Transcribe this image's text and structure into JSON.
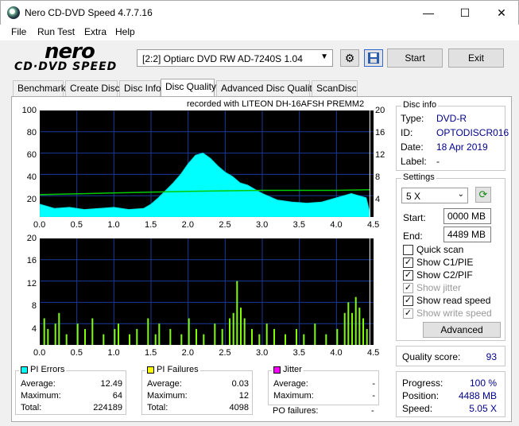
{
  "window": {
    "title": "Nero CD-DVD Speed 4.7.7.16",
    "min": "—",
    "max": "☐",
    "close": "✕"
  },
  "menu": [
    "File",
    "Run Test",
    "Extra",
    "Help"
  ],
  "logo": {
    "top": "nero",
    "bottom": "CD·DVD SPEED"
  },
  "toolbar": {
    "drive": "[2:2]  Optiarc DVD RW AD-7240S 1.04",
    "start": "Start",
    "exit": "Exit"
  },
  "tabs": [
    "Benchmark",
    "Create Disc",
    "Disc Info",
    "Disc Quality",
    "Advanced Disc Quality",
    "ScanDisc"
  ],
  "recorded_with": "recorded with LITEON   DH-16AFSH PREMM2",
  "disc_info": {
    "title": "Disc info",
    "rows": [
      {
        "label": "Type:",
        "value": "DVD-R"
      },
      {
        "label": "ID:",
        "value": "OPTODISCR016"
      },
      {
        "label": "Date:",
        "value": "18 Apr 2019"
      },
      {
        "label": "Label:",
        "value": "-"
      }
    ]
  },
  "settings": {
    "title": "Settings",
    "speed": "5 X",
    "start_label": "Start:",
    "start_value": "0000 MB",
    "end_label": "End:",
    "end_value": "4489 MB",
    "checks": [
      {
        "label": "Quick scan",
        "checked": false,
        "disabled": false
      },
      {
        "label": "Show C1/PIE",
        "checked": true,
        "disabled": false
      },
      {
        "label": "Show C2/PIF",
        "checked": true,
        "disabled": false
      },
      {
        "label": "Show jitter",
        "checked": true,
        "disabled": true
      },
      {
        "label": "Show read speed",
        "checked": true,
        "disabled": false
      },
      {
        "label": "Show write speed",
        "checked": true,
        "disabled": true
      }
    ],
    "advanced": "Advanced"
  },
  "quality": {
    "label": "Quality score:",
    "value": "93"
  },
  "progress": {
    "rows": [
      {
        "label": "Progress:",
        "value": "100 %"
      },
      {
        "label": "Position:",
        "value": "4488 MB"
      },
      {
        "label": "Speed:",
        "value": "5.05 X"
      }
    ]
  },
  "pi_errors": {
    "title": "PI Errors",
    "color": "#00ffff",
    "rows": [
      {
        "label": "Average:",
        "value": "12.49"
      },
      {
        "label": "Maximum:",
        "value": "64"
      },
      {
        "label": "Total:",
        "value": "224189"
      }
    ]
  },
  "pi_failures": {
    "title": "PI Failures",
    "color": "#ffff00",
    "rows": [
      {
        "label": "Average:",
        "value": "0.03"
      },
      {
        "label": "Maximum:",
        "value": "12"
      },
      {
        "label": "Total:",
        "value": "4098"
      }
    ]
  },
  "jitter": {
    "title": "Jitter",
    "color": "#ff00ff",
    "rows": [
      {
        "label": "Average:",
        "value": "-"
      },
      {
        "label": "Maximum:",
        "value": "-"
      }
    ],
    "po_label": "PO failures:",
    "po_value": "-"
  },
  "chart_data": [
    {
      "type": "area",
      "x_ticks": [
        "0.0",
        "0.5",
        "1.0",
        "1.5",
        "2.0",
        "2.5",
        "3.0",
        "3.5",
        "4.0",
        "4.5"
      ],
      "y_left_ticks": [
        "100",
        "80",
        "60",
        "40",
        "20"
      ],
      "y_right_ticks": [
        "20",
        "16",
        "12",
        "8",
        "4"
      ],
      "xlim": [
        0,
        4.5
      ],
      "ylim": [
        0,
        100
      ],
      "y2lim": [
        0,
        20
      ],
      "series": [
        {
          "x": [
            0.0,
            0.2,
            0.4,
            0.6,
            0.8,
            1.0,
            1.2,
            1.4,
            1.5,
            1.6,
            1.7,
            1.8,
            1.9,
            2.0,
            2.1,
            2.2,
            2.3,
            2.4,
            2.5,
            2.6,
            2.7,
            2.8,
            2.9,
            3.0,
            3.2,
            3.4,
            3.6,
            3.8,
            4.0,
            4.2,
            4.4,
            4.45
          ],
          "y": [
            12,
            8,
            9,
            7,
            8,
            9,
            7,
            8,
            12,
            18,
            25,
            32,
            40,
            50,
            58,
            60,
            55,
            48,
            42,
            38,
            32,
            30,
            26,
            22,
            16,
            14,
            13,
            14,
            18,
            22,
            18,
            4
          ]
        },
        {
          "x": [
            0.0,
            1.0,
            2.0,
            3.0,
            4.0,
            4.45
          ],
          "y": [
            4.2,
            4.5,
            4.8,
            5.0,
            5.0,
            5.1
          ]
        }
      ],
      "grid": true
    },
    {
      "type": "bar",
      "x_ticks": [
        "0.0",
        "0.5",
        "1.0",
        "1.5",
        "2.0",
        "2.5",
        "3.0",
        "3.5",
        "4.0",
        "4.5"
      ],
      "y_ticks": [
        "20",
        "16",
        "12",
        "8",
        "4"
      ],
      "xlim": [
        0,
        4.5
      ],
      "ylim": [
        0,
        20
      ],
      "series": [
        {
          "x": [
            0.05,
            0.1,
            0.2,
            0.25,
            0.35,
            0.5,
            0.6,
            0.7,
            0.85,
            1.0,
            1.05,
            1.2,
            1.3,
            1.45,
            1.55,
            1.6,
            1.75,
            1.9,
            2.0,
            2.1,
            2.2,
            2.35,
            2.45,
            2.55,
            2.6,
            2.65,
            2.7,
            2.75,
            2.85,
            2.95,
            3.05,
            3.15,
            3.3,
            3.45,
            3.55,
            3.7,
            3.85,
            4.0,
            4.1,
            4.15,
            4.2,
            4.25,
            4.3,
            4.35,
            4.4
          ],
          "y": [
            5,
            3,
            4,
            6,
            2,
            4,
            3,
            5,
            2,
            3,
            4,
            2,
            3,
            5,
            2,
            4,
            3,
            2,
            5,
            3,
            2,
            4,
            3,
            5,
            6,
            12,
            7,
            5,
            3,
            2,
            4,
            3,
            2,
            3,
            2,
            4,
            2,
            3,
            6,
            8,
            6,
            9,
            7,
            5,
            3
          ]
        }
      ],
      "grid": true
    }
  ]
}
